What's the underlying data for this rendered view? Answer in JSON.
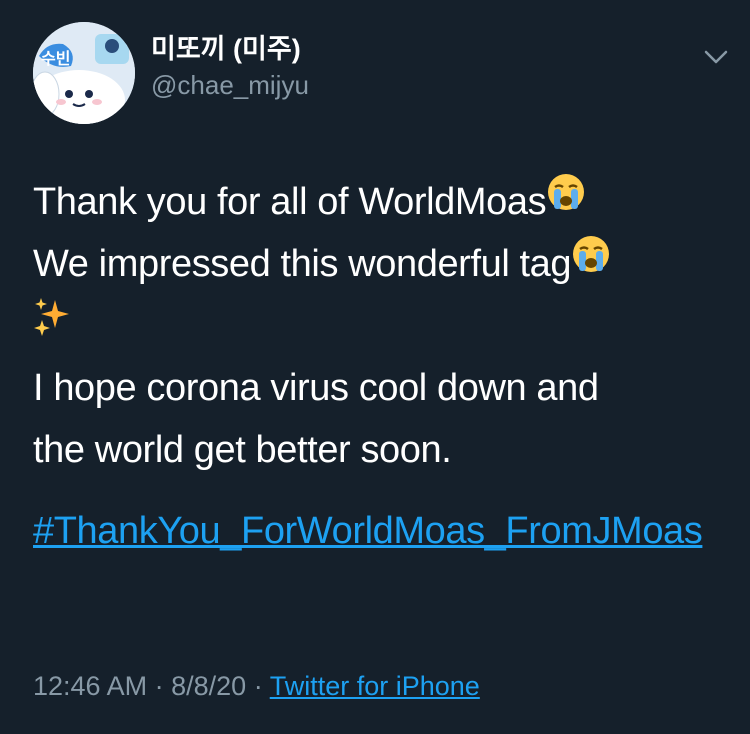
{
  "author": {
    "display_name": "미또끼 (미주)",
    "username": "@chae_mijyu",
    "avatar_label": "수빈"
  },
  "icons": {
    "more": "chevron-down-icon",
    "emoji_cry": "loudly-crying-face-emoji",
    "emoji_sparkles": "sparkles-emoji"
  },
  "tweet": {
    "line1": "Thank you for all of WorldMoas",
    "line2": "We impressed this wonderful tag",
    "line3": "I hope corona virus cool down and",
    "line4": "the world get better soon.",
    "hashtag": "#ThankYou_ForWorldMoas_FromJMoas"
  },
  "meta": {
    "time": "12:46 AM",
    "separator": "·",
    "date": "8/8/20",
    "source": "Twitter for iPhone"
  },
  "colors": {
    "background": "#15202b",
    "text": "#ffffff",
    "secondary": "#8899a6",
    "link": "#1da1f2"
  }
}
